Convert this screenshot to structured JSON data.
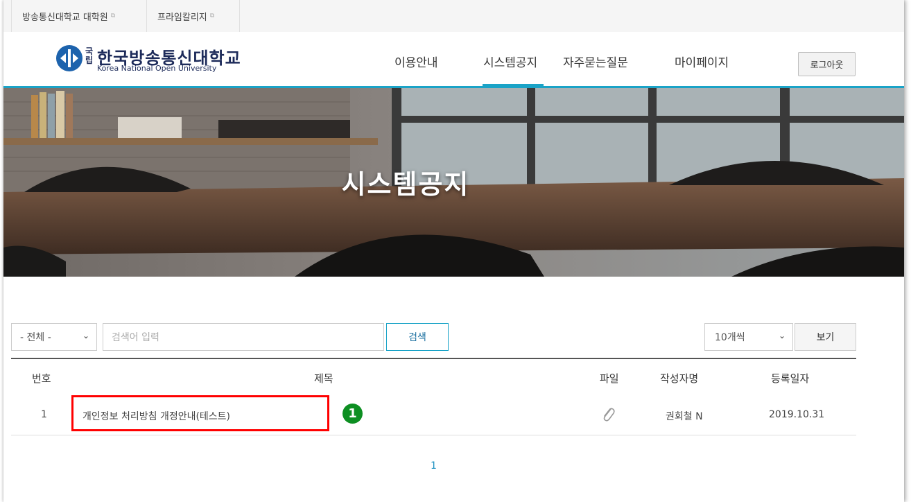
{
  "top_links": [
    {
      "label": "방송통신대학교 대학원",
      "icon": "external-link-icon"
    },
    {
      "label": "프라임칼리지",
      "icon": "external-link-icon"
    }
  ],
  "logo": {
    "small": "국립",
    "korean": "한국방송통신대학교",
    "english": "Korea National Open University"
  },
  "nav": {
    "items": [
      "이용안내",
      "시스템공지",
      "자주묻는질문",
      "마이페이지"
    ],
    "active": "시스템공지",
    "logout_label": "로그아웃"
  },
  "banner": {
    "title": "시스템공지"
  },
  "search": {
    "category": "- 전체 -",
    "placeholder": "검색어 입력",
    "button_label": "검색",
    "page_size": "10개씩",
    "view_label": "보기"
  },
  "table": {
    "headers": [
      "번호",
      "제목",
      "파일",
      "작성자명",
      "등록일자"
    ],
    "rows": [
      {
        "no": "1",
        "title": "개인정보 처리방침 개정안내(테스트)",
        "file_icon": "paperclip-icon",
        "author": "권회철 N",
        "date": "2019.10.31"
      }
    ]
  },
  "annotation": {
    "number": "1",
    "highlight_color": "#ff0000",
    "badge_color": "#0d8f22"
  },
  "pagination": {
    "pages": [
      "1"
    ],
    "current": "1"
  },
  "colors": {
    "accent": "#1aa3c7",
    "brand": "#1d63ad"
  }
}
